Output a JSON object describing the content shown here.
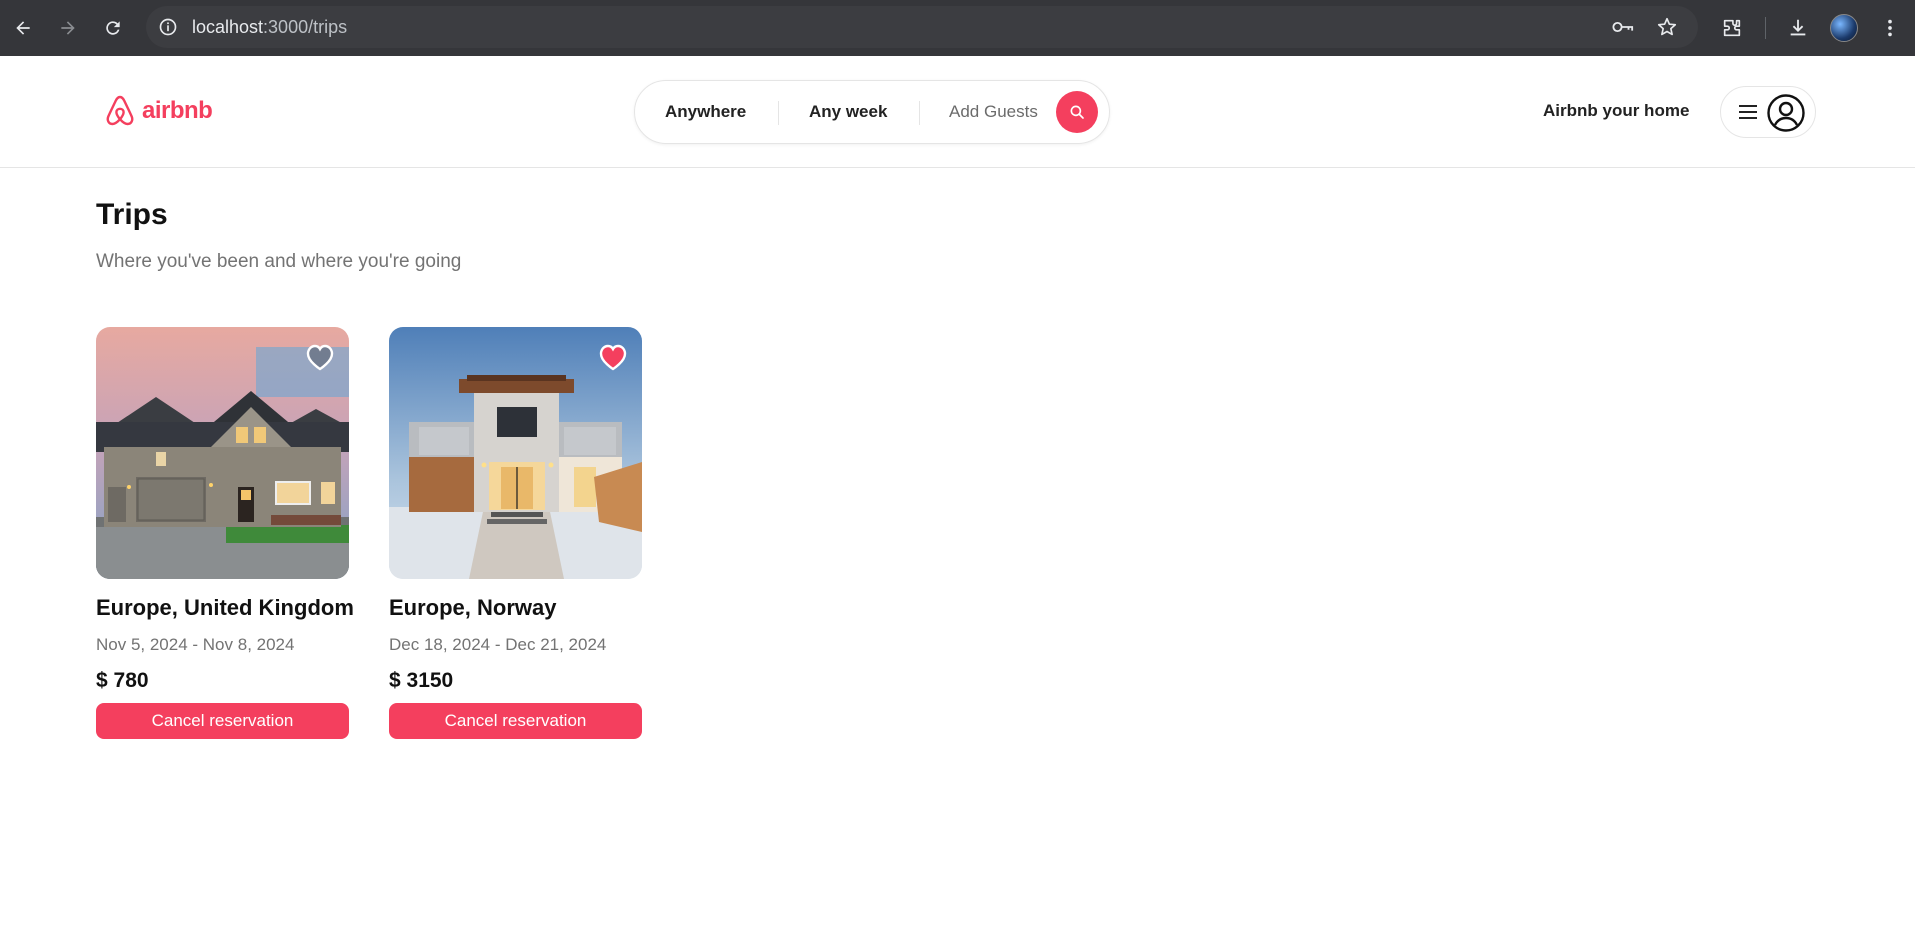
{
  "browser": {
    "url_host": "localhost",
    "url_path": ":3000/trips"
  },
  "header": {
    "brand": "airbnb",
    "search": {
      "where": "Anywhere",
      "when": "Any week",
      "guests": "Add Guests"
    },
    "host_link": "Airbnb your home"
  },
  "page": {
    "title": "Trips",
    "subtitle": "Where you've been and where you're going"
  },
  "trips": [
    {
      "location": "Europe, United Kingdom",
      "dates": "Nov 5, 2024 - Nov 8, 2024",
      "price": "$ 780",
      "cancel_label": "Cancel reservation",
      "favorited": false
    },
    {
      "location": "Europe, Norway",
      "dates": "Dec 18, 2024 - Dec 21, 2024",
      "price": "$ 3150",
      "cancel_label": "Cancel reservation",
      "favorited": true
    }
  ],
  "colors": {
    "accent": "#f43f5e",
    "chrome_bg": "#35363a"
  }
}
